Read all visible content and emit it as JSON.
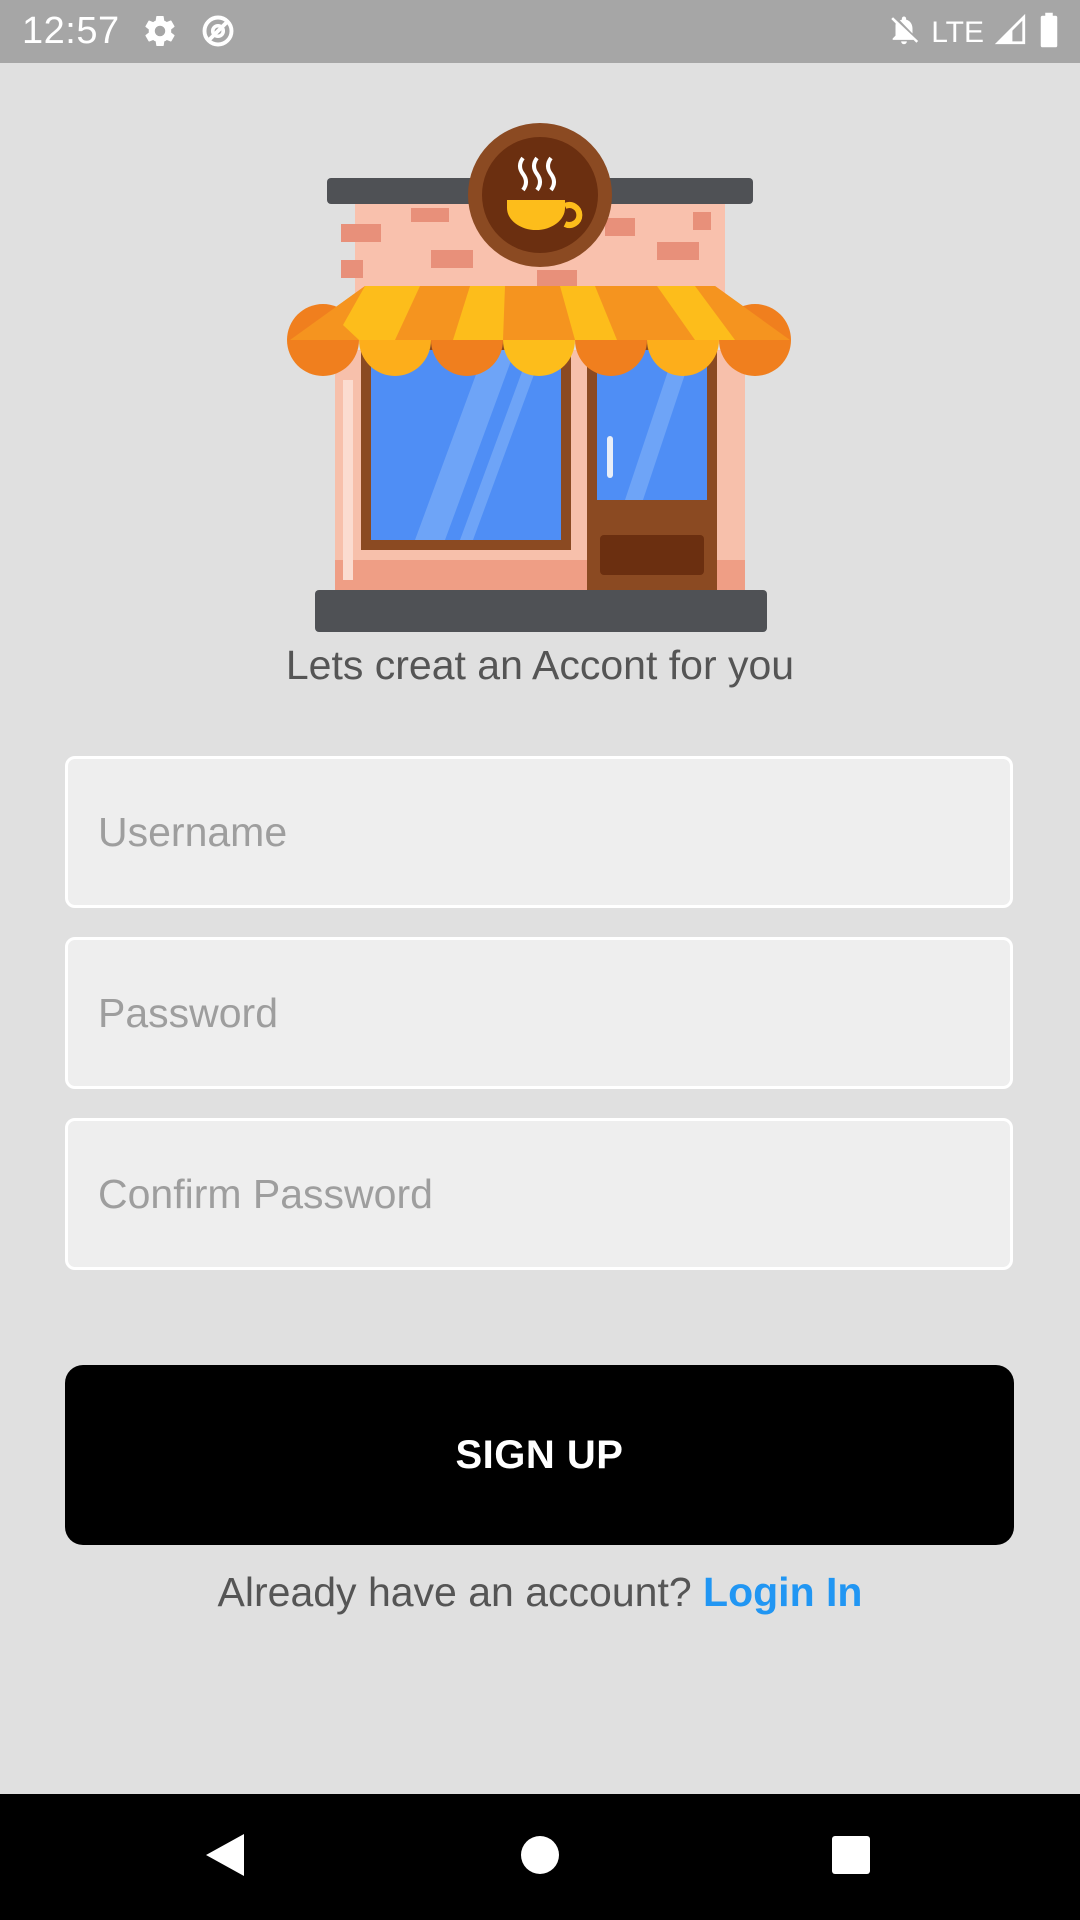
{
  "status_bar": {
    "time": "12:57",
    "network_label": "LTE",
    "icons": [
      "settings-icon",
      "data-saver-icon",
      "notifications-off-icon",
      "signal-icon",
      "battery-icon"
    ]
  },
  "header": {
    "illustration": "coffee-shop-storefront",
    "subtitle": "Lets creat an Accont for you"
  },
  "form": {
    "username_placeholder": "Username",
    "password_placeholder": "Password",
    "confirm_password_placeholder": "Confirm Password",
    "signup_label": "SIGN UP"
  },
  "footer": {
    "prompt": "Already have an account?",
    "login_label": "Login In",
    "link_color": "#2196f3"
  },
  "nav_bar": {
    "buttons": [
      "back-icon",
      "home-icon",
      "recents-icon"
    ]
  },
  "colors": {
    "background": "#e0e0e0",
    "status_bar": "#a6a6a6",
    "button": "#000000"
  }
}
